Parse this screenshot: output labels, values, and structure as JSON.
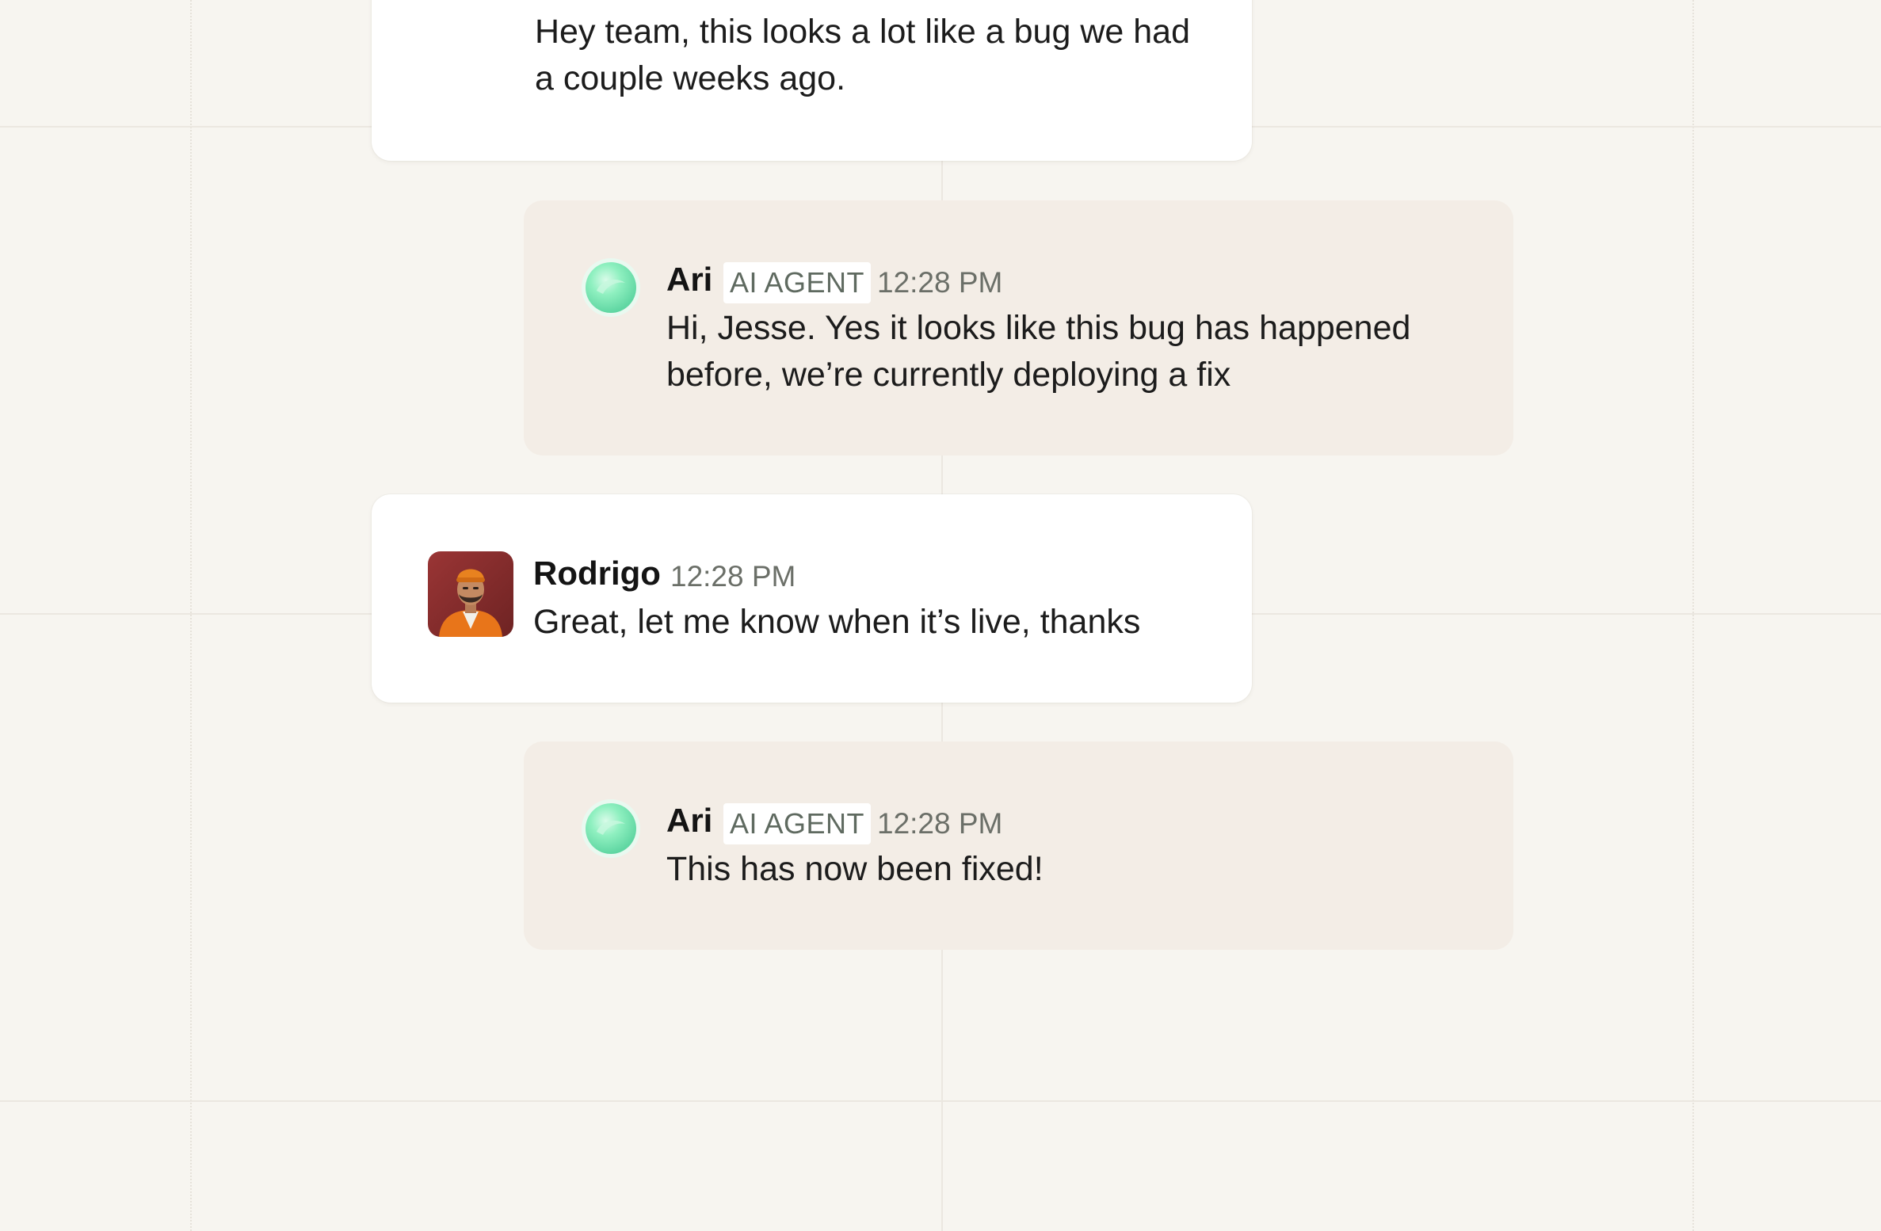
{
  "thread": {
    "messages": [
      {
        "author": "",
        "time": "",
        "text": "Hey team, this looks a lot like a bug we had a couple weeks ago."
      },
      {
        "author": "Ari",
        "badge": "AI AGENT",
        "time": "12:28 PM",
        "text": "Hi, Jesse. Yes it looks like this bug has happened before, we’re currently deploying a fix"
      },
      {
        "author": "Rodrigo",
        "time": "12:28 PM",
        "text": "Great, let me know when it’s live, thanks"
      },
      {
        "author": "Ari",
        "badge": "AI AGENT",
        "time": "12:28 PM",
        "text": "This has now been fixed!"
      }
    ]
  },
  "colors": {
    "page_background": "#f7f5f0",
    "user_card": "#ffffff",
    "agent_card": "#f3ede6",
    "badge_text": "#5f6a60",
    "orb": "#7fe3b4",
    "avatar_background": "#8a2e2e",
    "jacket": "#e8751a"
  },
  "icons": {
    "user_avatar": "person-avatar-photo",
    "agent_avatar": "ai-orb-icon"
  }
}
